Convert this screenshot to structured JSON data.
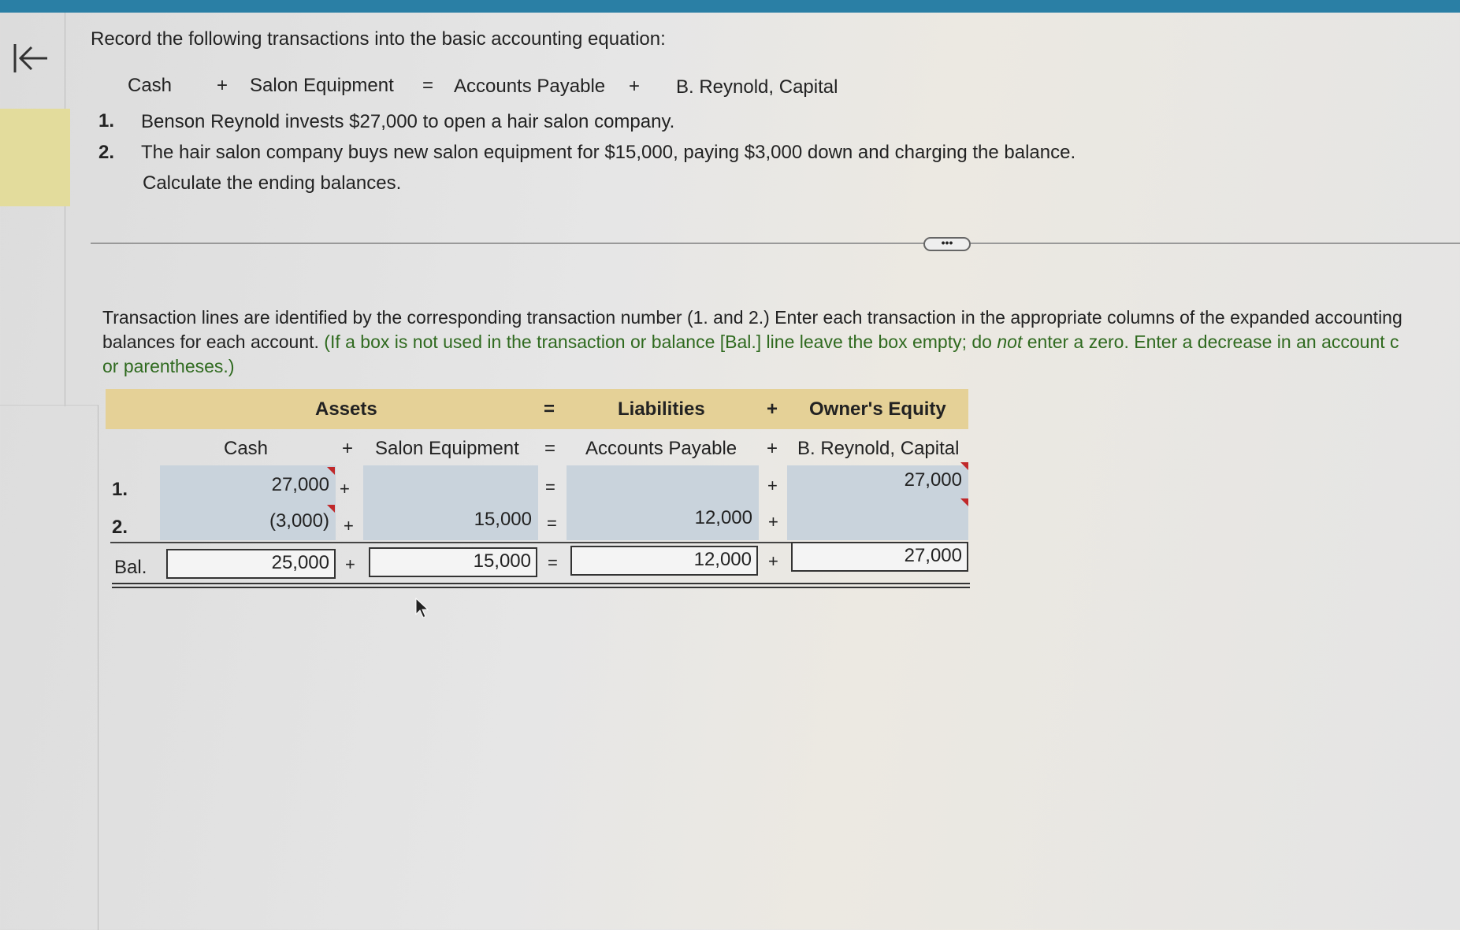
{
  "question": {
    "title": "Record the following transactions into the basic accounting equation:",
    "equation": [
      "Cash",
      "+",
      "Salon Equipment",
      "=",
      "Accounts Payable",
      "+",
      "B. Reynold, Capital"
    ],
    "items": [
      {
        "num": "1.",
        "text": "Benson Reynold invests $27,000 to open a hair salon company."
      },
      {
        "num": "2.",
        "text": "The hair salon company buys new salon equipment for $15,000, paying $3,000 down and charging the balance."
      }
    ],
    "extra": "Calculate the ending balances."
  },
  "divider_label": "•••",
  "instructions": {
    "line1": "Transaction lines are identified by the corresponding transaction number (1. and 2.) Enter each transaction in the appropriate columns of the expanded accounting",
    "line2a": "balances for each account. ",
    "line2b": "(If a box is not used in the transaction or balance [Bal.] line leave the box empty; do ",
    "line2c": "not",
    "line2d": " enter a zero. Enter a decrease in an account c",
    "line3": "or parentheses.)"
  },
  "table": {
    "groups": {
      "assets": "Assets",
      "eq": "=",
      "liabilities": "Liabilities",
      "plus": "+",
      "equity": "Owner's Equity"
    },
    "columns": [
      "Cash",
      "Salon Equipment",
      "Accounts Payable",
      "B. Reynold, Capital"
    ],
    "ops": [
      "+",
      "=",
      "+"
    ],
    "rows": [
      {
        "label": "1.",
        "cash": "27,000",
        "equipment": "",
        "payable": "",
        "capital": "27,000"
      },
      {
        "label": "2.",
        "cash": "(3,000)",
        "equipment": "15,000",
        "payable": "12,000",
        "capital": ""
      },
      {
        "label": "Bal.",
        "cash": "25,000",
        "equipment": "15,000",
        "payable": "12,000",
        "capital": "27,000"
      }
    ]
  },
  "colors": {
    "header_band": "#e5d197",
    "cell": "#c9d3dc",
    "top_bar": "#2a7fa5",
    "error_flag": "#c0282a"
  }
}
